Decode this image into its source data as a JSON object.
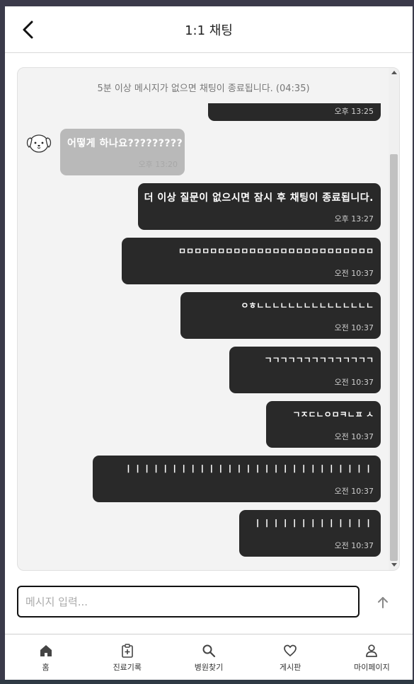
{
  "header": {
    "title": "1:1 채팅"
  },
  "notice": "5분 이상 메시지가 없으면 채팅이 종료됩니다. (04:35)",
  "messages": [
    {
      "text": "",
      "time": "오후 13:25"
    },
    {
      "text": "어떻게 하나요?????????",
      "time": "오후 13:20"
    },
    {
      "text": "더 이상 질문이 없으시면 잠시 후 채팅이 종료됩니다.",
      "time": "오후 13:27"
    },
    {
      "text": "ㅁㅁㅁㅁㅁㅁㅁㅁㅁㅁㅁㅁㅁㅁㅁㅁㅁㅁㅁㅁㅁㅁㅁㅁㅁ",
      "time": "오전 10:37"
    },
    {
      "text": "ㅇㅎㄴㄴㄴㄴㄴㄴㄴㄴㄴㄴㄴㄴㄴㄴㄴ",
      "time": "오전 10:37"
    },
    {
      "text": "ㄱㄱㄱㄱㄱㄱㄱㄱㄱㄱㄱㄱㄱㄱ",
      "time": "오전 10:37"
    },
    {
      "text": "ㄱㅈㄷㄴㅇㅁㅋㄴㅍ ㅅ",
      "time": "오전 10:37"
    },
    {
      "text": "ㅣㅣㅣㅣㅣㅣㅣㅣㅣㅣㅣㅣㅣㅣㅣㅣㅣㅣㅣㅣㅣㅣㅣㅣㅣㅣㅣ",
      "time": "오전 10:37"
    },
    {
      "text": "ㅣㅣㅣㅣㅣㅣㅣㅣㅣㅣㅣㅣㅣ",
      "time": "오전 10:37"
    }
  ],
  "input": {
    "placeholder": "메시지 입력..."
  },
  "nav": [
    {
      "label": "홈",
      "icon": "home-icon"
    },
    {
      "label": "진료기록",
      "icon": "medical-record-icon"
    },
    {
      "label": "병원찾기",
      "icon": "search-icon"
    },
    {
      "label": "게시판",
      "icon": "heart-icon"
    },
    {
      "label": "마이페이지",
      "icon": "user-icon"
    }
  ],
  "colors": {
    "bubble_dark": "#292929",
    "bubble_grey": "#b9b9b9",
    "panel_bg": "#f3f3f3"
  }
}
